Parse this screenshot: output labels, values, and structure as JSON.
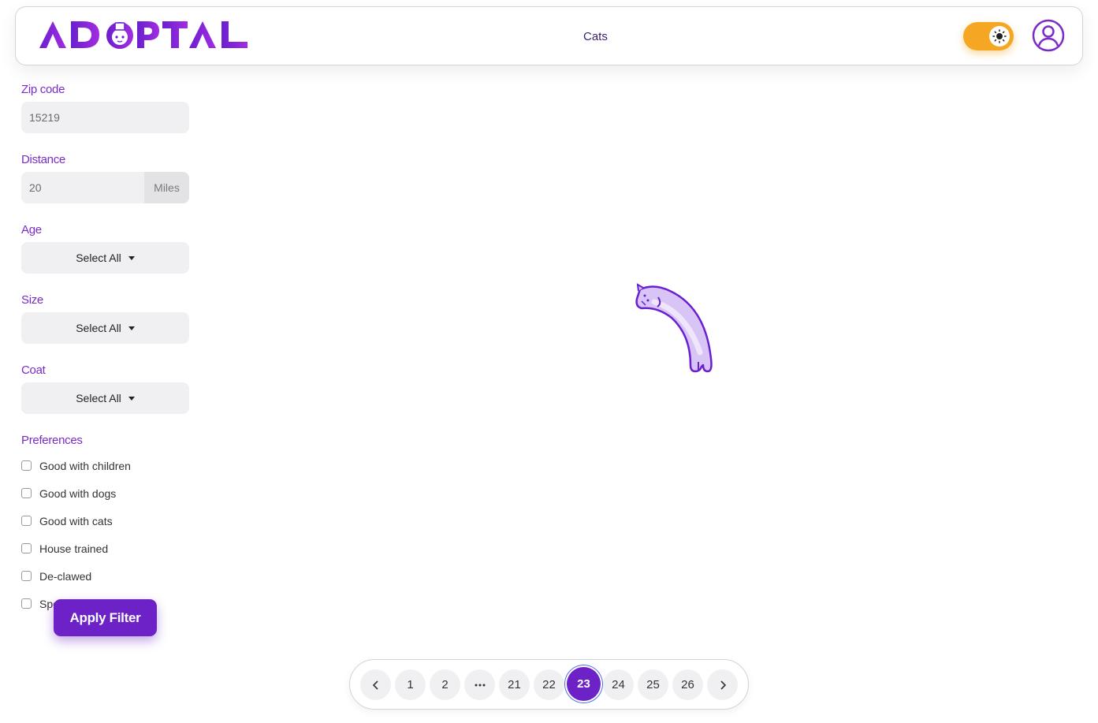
{
  "header": {
    "logo_text": "ADOPTAL",
    "nav_link": "Cats",
    "theme_toggle_state": "light",
    "accent_color": "#7a2bc8",
    "toggle_color": "#f5a623"
  },
  "filters": {
    "zip": {
      "label": "Zip code",
      "value": "15219"
    },
    "distance": {
      "label": "Distance",
      "value": "20",
      "unit": "Miles"
    },
    "age": {
      "label": "Age",
      "value": "Select All"
    },
    "size": {
      "label": "Size",
      "value": "Select All"
    },
    "coat": {
      "label": "Coat",
      "value": "Select All"
    },
    "preferences": {
      "label": "Preferences",
      "items": [
        {
          "label": "Good with children",
          "checked": false
        },
        {
          "label": "Good with dogs",
          "checked": false
        },
        {
          "label": "Good with cats",
          "checked": false
        },
        {
          "label": "House trained",
          "checked": false
        },
        {
          "label": "De-clawed",
          "checked": false
        },
        {
          "label": "Special needs",
          "checked": false
        }
      ]
    },
    "apply_label": "Apply Filter"
  },
  "pagination": {
    "pages": [
      "1",
      "2",
      "...",
      "21",
      "22",
      "23",
      "24",
      "25",
      "26"
    ],
    "current": "23"
  }
}
